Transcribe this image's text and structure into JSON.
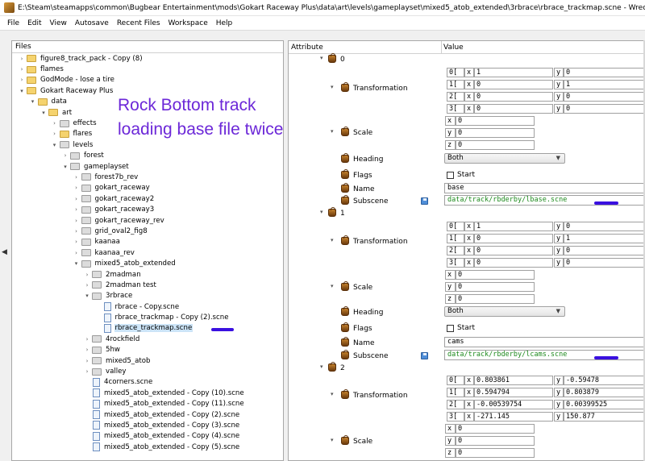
{
  "window": {
    "title": "E:\\Steam\\steamapps\\common\\Bugbear Entertainment\\mods\\Gokart Raceway Plus\\data\\art\\levels\\gameplayset\\mixed5_atob_extended\\3rbrace\\rbrace_trackmap.scne - Wreckfest - Bag Edit"
  },
  "menu": [
    "File",
    "Edit",
    "View",
    "Autosave",
    "Recent Files",
    "Workspace",
    "Help"
  ],
  "files_panel": {
    "header": "Files",
    "tree": [
      {
        "label": "figure8_track_pack - Copy (8)",
        "depth": 1,
        "expander": "closed",
        "icon": "folder"
      },
      {
        "label": "flames",
        "depth": 1,
        "expander": "closed",
        "icon": "folder"
      },
      {
        "label": "GodMode - lose a tire",
        "depth": 1,
        "expander": "closed",
        "icon": "folder"
      },
      {
        "label": "Gokart Raceway Plus",
        "depth": 1,
        "expander": "open",
        "icon": "folder"
      },
      {
        "label": "data",
        "depth": 2,
        "expander": "open",
        "icon": "folder"
      },
      {
        "label": "art",
        "depth": 3,
        "expander": "open",
        "icon": "folder"
      },
      {
        "label": "effects",
        "depth": 4,
        "expander": "closed",
        "icon": "folder-gray"
      },
      {
        "label": "flares",
        "depth": 4,
        "expander": "closed",
        "icon": "folder"
      },
      {
        "label": "levels",
        "depth": 4,
        "expander": "open",
        "icon": "folder-gray"
      },
      {
        "label": "forest",
        "depth": 5,
        "expander": "closed",
        "icon": "folder-gray"
      },
      {
        "label": "gameplayset",
        "depth": 5,
        "expander": "open",
        "icon": "folder-gray"
      },
      {
        "label": "forest7b_rev",
        "depth": 6,
        "expander": "closed",
        "icon": "folder-gray"
      },
      {
        "label": "gokart_raceway",
        "depth": 6,
        "expander": "closed",
        "icon": "folder-gray"
      },
      {
        "label": "gokart_raceway2",
        "depth": 6,
        "expander": "closed",
        "icon": "folder-gray"
      },
      {
        "label": "gokart_raceway3",
        "depth": 6,
        "expander": "closed",
        "icon": "folder-gray"
      },
      {
        "label": "gokart_raceway_rev",
        "depth": 6,
        "expander": "closed",
        "icon": "folder-gray"
      },
      {
        "label": "grid_oval2_fig8",
        "depth": 6,
        "expander": "closed",
        "icon": "folder-gray"
      },
      {
        "label": "kaanaa",
        "depth": 6,
        "expander": "closed",
        "icon": "folder-gray"
      },
      {
        "label": "kaanaa_rev",
        "depth": 6,
        "expander": "closed",
        "icon": "folder-gray"
      },
      {
        "label": "mixed5_atob_extended",
        "depth": 6,
        "expander": "open",
        "icon": "folder-gray"
      },
      {
        "label": "2madman",
        "depth": 7,
        "expander": "closed",
        "icon": "folder-gray"
      },
      {
        "label": "2madman test",
        "depth": 7,
        "expander": "closed",
        "icon": "folder-gray"
      },
      {
        "label": "3rbrace",
        "depth": 7,
        "expander": "open",
        "icon": "folder-gray"
      },
      {
        "label": "rbrace - Copy.scne",
        "depth": 8,
        "expander": "none",
        "icon": "file"
      },
      {
        "label": "rbrace_trackmap - Copy (2).scne",
        "depth": 8,
        "expander": "none",
        "icon": "file"
      },
      {
        "label": "rbrace_trackmap.scne",
        "depth": 8,
        "expander": "none",
        "icon": "file"
      },
      {
        "label": "4rockfield",
        "depth": 7,
        "expander": "closed",
        "icon": "folder-gray"
      },
      {
        "label": "5hw",
        "depth": 7,
        "expander": "closed",
        "icon": "folder-gray"
      },
      {
        "label": "mixed5_atob",
        "depth": 7,
        "expander": "closed",
        "icon": "folder-gray"
      },
      {
        "label": "valley",
        "depth": 7,
        "expander": "closed",
        "icon": "folder-gray"
      },
      {
        "label": "4corners.scne",
        "depth": 7,
        "expander": "none",
        "icon": "file"
      },
      {
        "label": "mixed5_atob_extended - Copy (10).scne",
        "depth": 7,
        "expander": "none",
        "icon": "file"
      },
      {
        "label": "mixed5_atob_extended - Copy (11).scne",
        "depth": 7,
        "expander": "none",
        "icon": "file"
      },
      {
        "label": "mixed5_atob_extended - Copy (2).scne",
        "depth": 7,
        "expander": "none",
        "icon": "file"
      },
      {
        "label": "mixed5_atob_extended - Copy (3).scne",
        "depth": 7,
        "expander": "none",
        "icon": "file"
      },
      {
        "label": "mixed5_atob_extended - Copy (4).scne",
        "depth": 7,
        "expander": "none",
        "icon": "file"
      },
      {
        "label": "mixed5_atob_extended - Copy (5).scne",
        "depth": 7,
        "expander": "none",
        "icon": "file"
      }
    ]
  },
  "annotation": {
    "line1": "Rock Bottom track",
    "line2": "loading base file twice",
    "color": "#6c28d8",
    "mark_color": "#3a10e0"
  },
  "attr_panel": {
    "col_attribute": "Attribute",
    "col_value": "Value",
    "labels": {
      "transformation": "Transformation",
      "scale": "Scale",
      "heading": "Heading",
      "flags": "Flags",
      "name": "Name",
      "subscene": "Subscene",
      "start": "Start"
    },
    "matrix_row_labels": [
      "0[",
      "1[",
      "2[",
      "3["
    ],
    "axis": {
      "x": "x",
      "y": "y",
      "z": "z"
    },
    "nodes": [
      {
        "index": "0",
        "transform": [
          [
            "1",
            "0"
          ],
          [
            "0",
            "1"
          ],
          [
            "0",
            "0"
          ],
          [
            "0",
            "0"
          ]
        ],
        "scale": [
          "0",
          "0",
          "0"
        ],
        "heading": "Both",
        "name": "base",
        "subscene": "data/track/rbderby/lbase.scne"
      },
      {
        "index": "1",
        "transform": [
          [
            "1",
            "0"
          ],
          [
            "0",
            "1"
          ],
          [
            "0",
            "0"
          ],
          [
            "0",
            "0"
          ]
        ],
        "scale": [
          "0",
          "0",
          "0"
        ],
        "heading": "Both",
        "name": "cams",
        "subscene": "data/track/rbderby/lcams.scne"
      },
      {
        "index": "2",
        "transform": [
          [
            "0.803861",
            "-0.59478"
          ],
          [
            "0.594794",
            "0.803879"
          ],
          [
            "-0.00539754",
            "0.00399525"
          ],
          [
            "-271.145",
            "150.877"
          ]
        ],
        "scale": [
          "0",
          "0",
          "0"
        ]
      }
    ]
  },
  "icons": {
    "app": "bag-edit-app-icon",
    "node": "bag-icon",
    "save": "floppy-disk-icon",
    "folder": "folder-icon",
    "file": "scne-file-icon"
  }
}
